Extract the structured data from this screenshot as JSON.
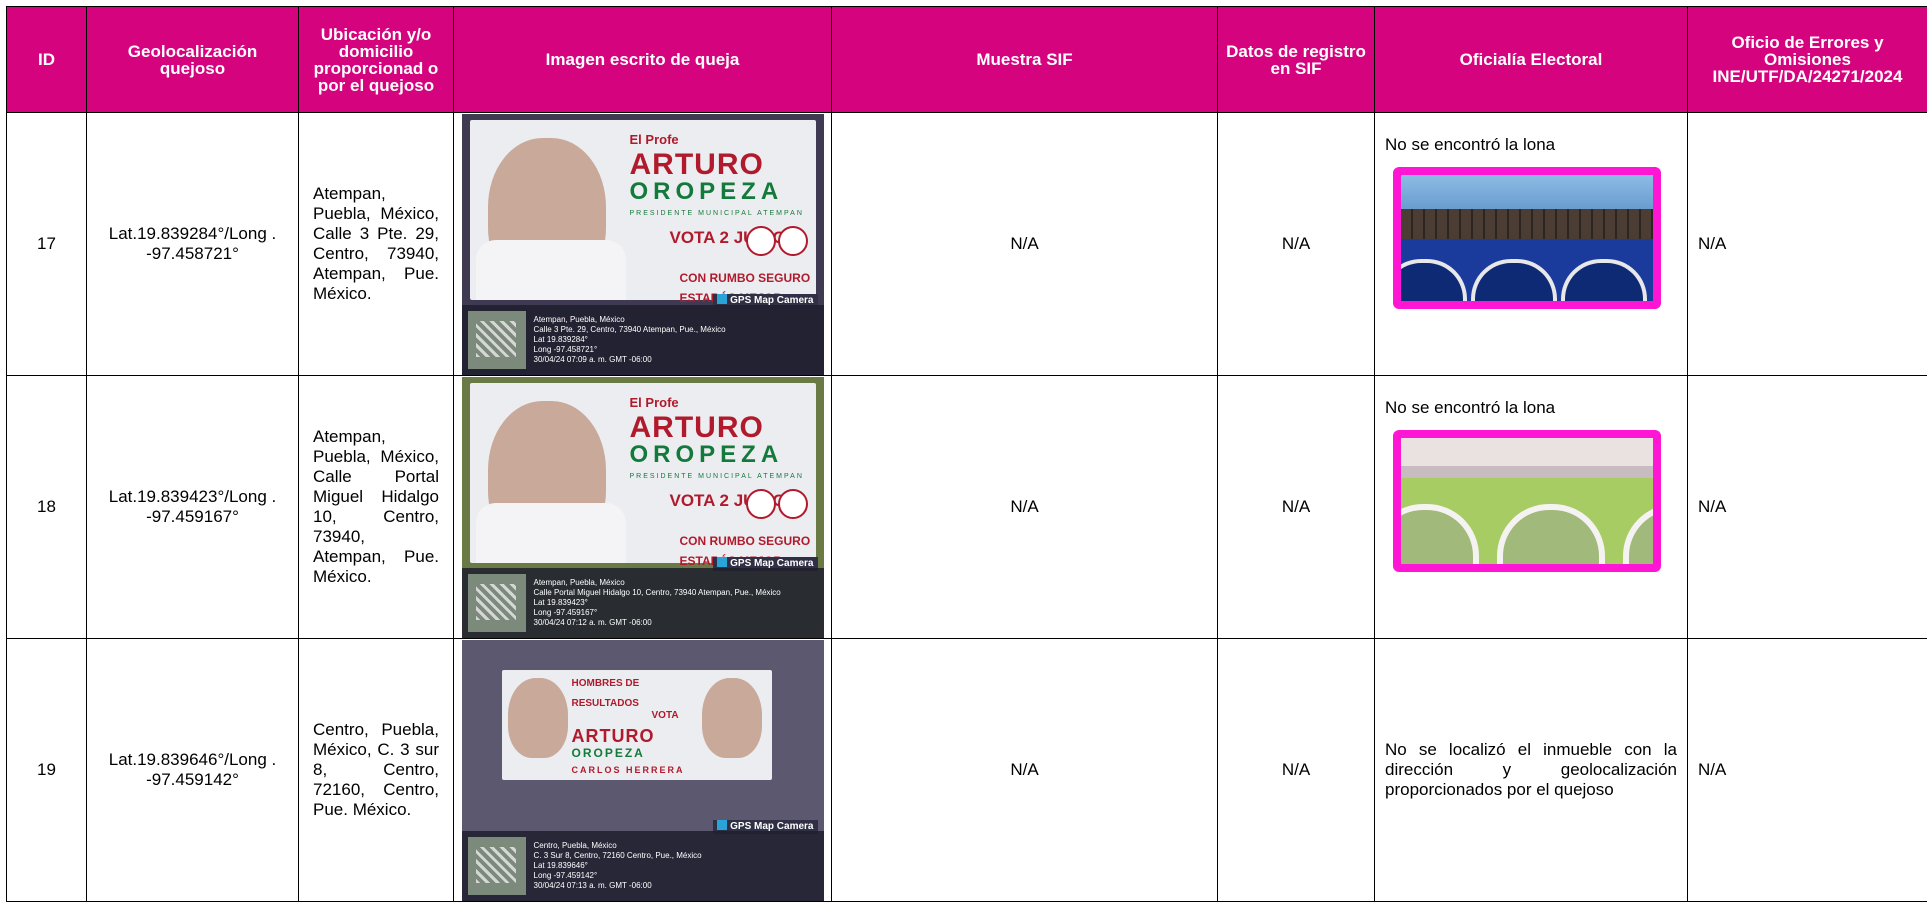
{
  "headers": {
    "id": "ID",
    "geo": "Geolocalización quejoso",
    "ubicacion": "Ubicación y/o domicilio proporcionad o por el quejoso",
    "imagen": "Imagen escrito de queja",
    "muestra": "Muestra SIF",
    "datos": "Datos de registro en SIF",
    "oficialia": "Oficialía Electoral",
    "oficio": "Oficio de Errores y Omisiones INE/UTF/DA/24271/2024"
  },
  "rows": [
    {
      "id": "17",
      "geo": "Lat.19.839284°/Long . -97.458721°",
      "address": "Atempan, Puebla, México, Calle 3 Pte. 29, Centro, 73940, Atempan, Pue. México.",
      "photo": {
        "banner_l1": "El Profe",
        "banner_l2": "ARTURO",
        "banner_l3": "OROPEZA",
        "banner_l4": "PRESIDENTE MUNICIPAL ATEMPAN",
        "vote": "VOTA 2 JUNIO",
        "rumbo": "CON RUMBO SEGURO ESTARÁS MEJOR",
        "gps_label": "GPS Map Camera",
        "gps_line1": "Atempan, Puebla, México",
        "gps_line2": "Calle 3 Pte. 29, Centro, 73940 Atempan, Pue., México",
        "gps_line3": "Lat 19.839284°",
        "gps_line4": "Long -97.458721°",
        "gps_line5": "30/04/24 07:09 a. m. GMT -06:00"
      },
      "muestra": "N/A",
      "datos": "N/A",
      "oficialia": "No se encontró la lona",
      "oficio": "N/A"
    },
    {
      "id": "18",
      "geo": "Lat.19.839423°/Long . -97.459167°",
      "address": "Atempan, Puebla, México, Calle Portal Miguel Hidalgo 10, Centro, 73940, Atempan, Pue. México.",
      "photo": {
        "banner_l1": "El Profe",
        "banner_l2": "ARTURO",
        "banner_l3": "OROPEZA",
        "banner_l4": "PRESIDENTE MUNICIPAL ATEMPAN",
        "vote": "VOTA 2 JUNIO",
        "rumbo": "CON RUMBO SEGURO ESTARÁS MEJOR",
        "gps_label": "GPS Map Camera",
        "gps_line1": "Atempan, Puebla, México",
        "gps_line2": "Calle Portal Miguel Hidalgo 10, Centro, 73940 Atempan, Pue., México",
        "gps_line3": "Lat 19.839423°",
        "gps_line4": "Long -97.459167°",
        "gps_line5": "30/04/24 07:12 a. m. GMT -06:00"
      },
      "muestra": "N/A",
      "datos": "N/A",
      "oficialia": "No se encontró la lona",
      "oficio": "N/A"
    },
    {
      "id": "19",
      "geo": "Lat.19.839646°/Long . -97.459142°",
      "address": "Centro, Puebla, México, C. 3 sur 8, Centro, 72160, Centro, Pue. México.",
      "photo": {
        "banner_l1": "HOMBRES DE RESULTADOS",
        "banner_l2": "ARTURO",
        "banner_l3": "OROPEZA",
        "banner_l4": "CARLOS HERRERA",
        "vote": "VOTA",
        "rumbo": "",
        "gps_label": "GPS Map Camera",
        "gps_line1": "Centro, Puebla, México",
        "gps_line2": "C. 3 Sur 8, Centro, 72160 Centro, Pue., México",
        "gps_line3": "Lat 19.839646°",
        "gps_line4": "Long -97.459142°",
        "gps_line5": "30/04/24 07:13 a. m. GMT -06:00"
      },
      "muestra": "N/A",
      "datos": "N/A",
      "oficialia": "No se localizó el inmueble con la dirección y geolocalización proporcionados por el quejoso",
      "oficio": "N/A"
    }
  ]
}
